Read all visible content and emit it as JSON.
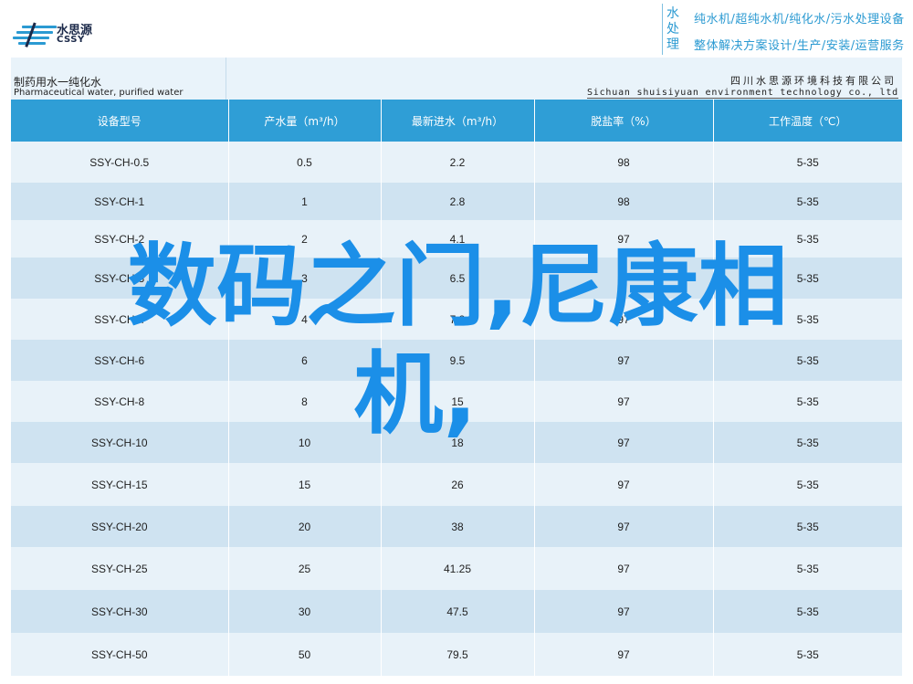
{
  "header": {
    "logo_cn": "水思源",
    "logo_en": "CSSY",
    "slogan_tag": "水处理",
    "slogan_line1": "纯水机/超纯水机/纯化水/污水处理设备",
    "slogan_line2": "整体解决方案设计/生产/安装/运营服务",
    "accent_color": "#2f9ed6"
  },
  "band": {
    "title_cn": "制药用水一纯化水",
    "title_en": "Pharmaceutical water, purified water",
    "company_cn": "四川水思源环境科技有限公司",
    "company_en": "Sichuan shuisiyuan environment technology co., ltd"
  },
  "table": {
    "headers": [
      "设备型号",
      "产水量（m³/h）",
      "最新进水（m³/h）",
      "脱盐率（%）",
      "工作温度（℃）"
    ],
    "rows": [
      [
        "SSY-CH-0.5",
        "0.5",
        "2.2",
        "98",
        "5-35"
      ],
      [
        "SSY-CH-1",
        "1",
        "2.8",
        "98",
        "5-35"
      ],
      [
        "SSY-CH-2",
        "2",
        "4.1",
        "97",
        "5-35"
      ],
      [
        "SSY-CH-3",
        "3",
        "6.5",
        "97",
        "5-35"
      ],
      [
        "SSY-CH-4",
        "4",
        "7.8",
        "97",
        "5-35"
      ],
      [
        "SSY-CH-6",
        "6",
        "9.5",
        "97",
        "5-35"
      ],
      [
        "SSY-CH-8",
        "8",
        "15",
        "97",
        "5-35"
      ],
      [
        "SSY-CH-10",
        "10",
        "18",
        "97",
        "5-35"
      ],
      [
        "SSY-CH-15",
        "15",
        "26",
        "97",
        "5-35"
      ],
      [
        "SSY-CH-20",
        "20",
        "38",
        "97",
        "5-35"
      ],
      [
        "SSY-CH-25",
        "25",
        "41.25",
        "97",
        "5-35"
      ],
      [
        "SSY-CH-30",
        "30",
        "47.5",
        "97",
        "5-35"
      ],
      [
        "SSY-CH-50",
        "50",
        "79.5",
        "97",
        "5-35"
      ]
    ]
  },
  "watermark": {
    "line1": "数码之门,尼康相",
    "line2": "机,",
    "color": "#1b8fe8"
  }
}
